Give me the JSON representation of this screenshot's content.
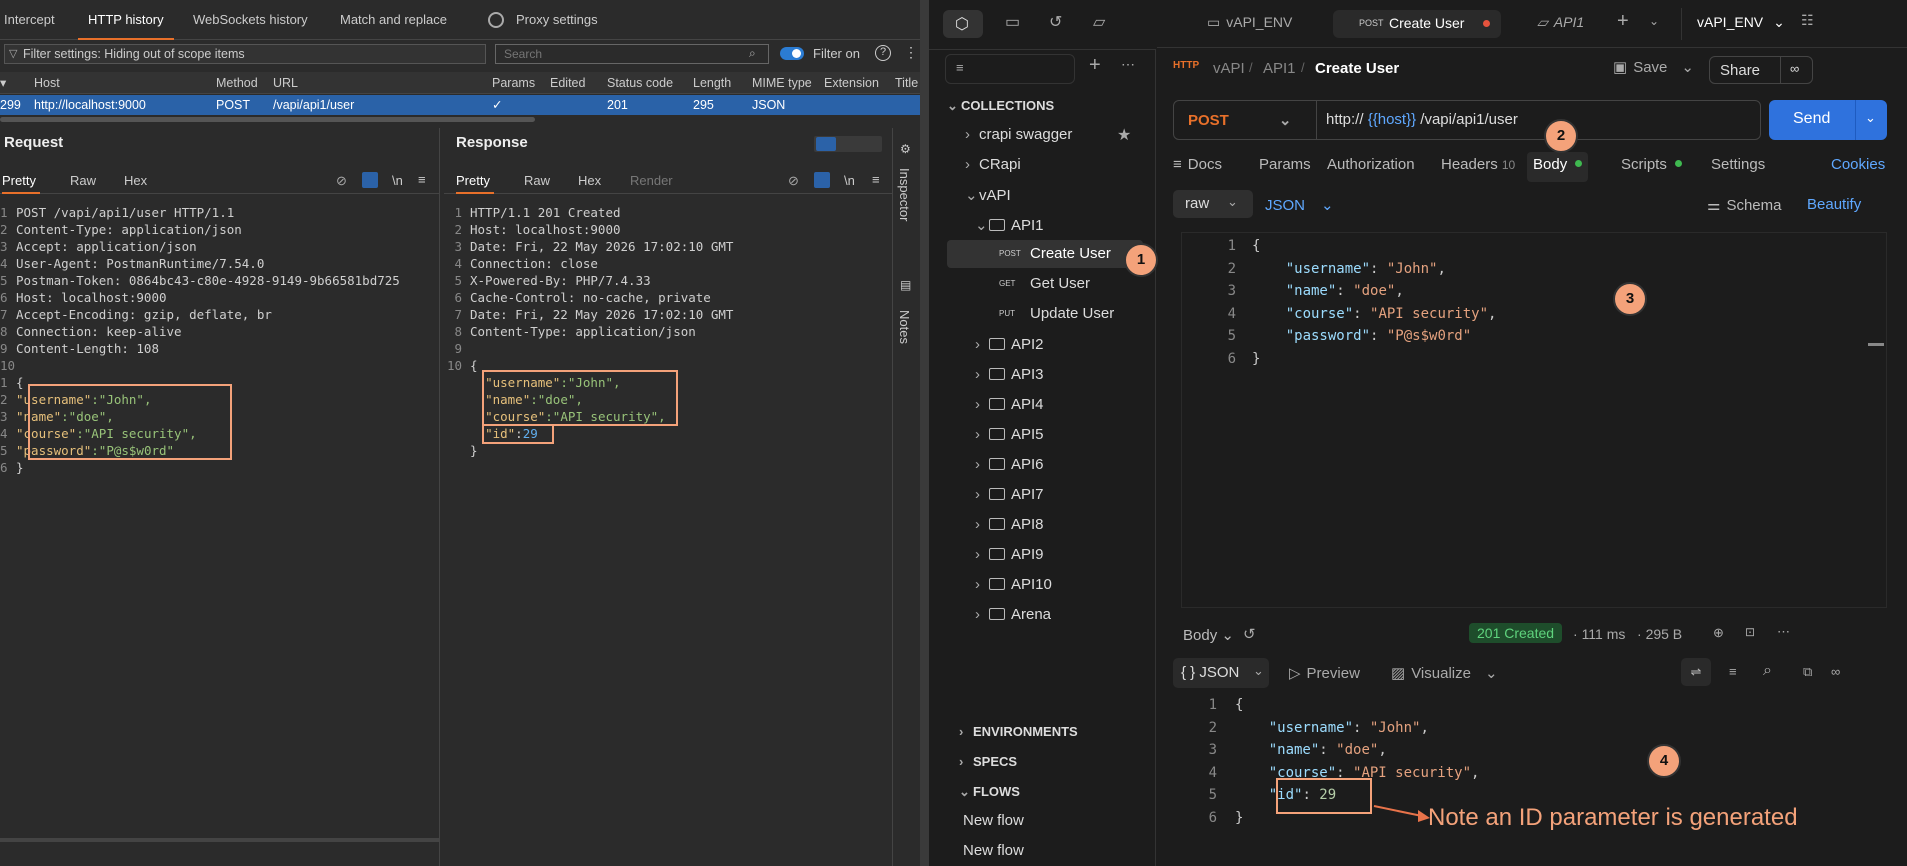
{
  "burp": {
    "tabs": [
      "Intercept",
      "HTTP history",
      "WebSockets history",
      "Match and replace",
      "Proxy settings"
    ],
    "filter_text": "Filter settings: Hiding out of scope items",
    "search_placeholder": "Search",
    "filter_on": "Filter on",
    "columns": [
      "#",
      "Host",
      "Method",
      "URL",
      "Params",
      "Edited",
      "Status code",
      "Length",
      "MIME type",
      "Extension",
      "Title"
    ],
    "row": {
      "num": "299",
      "host": "http://localhost:9000",
      "method": "POST",
      "url": "/vapi/api1/user",
      "params": "✓",
      "edited": "",
      "status": "201",
      "length": "295",
      "mime": "JSON",
      "ext": "",
      "title": ""
    },
    "request": {
      "title": "Request",
      "tabs": [
        "Pretty",
        "Raw",
        "Hex"
      ],
      "lines": [
        "POST /vapi/api1/user HTTP/1.1",
        "Content-Type: application/json",
        "Accept: application/json",
        "User-Agent: PostmanRuntime/7.54.0",
        "Postman-Token: 0864bc43-c80e-4928-9149-9b66581bd725",
        "Host: localhost:9000",
        "Accept-Encoding: gzip, deflate, br",
        "Connection: keep-alive",
        "Content-Length: 108",
        "",
        "{"
      ],
      "body": [
        [
          "\"username\"",
          ":\"John\","
        ],
        [
          "\"name\"",
          ":\"doe\","
        ],
        [
          "\"course\"",
          ":\"API security\","
        ],
        [
          "\"password\"",
          ":\"P@s$w0rd\""
        ]
      ],
      "close": "}",
      "numbers": [
        "1",
        "2",
        "3",
        "4",
        "5",
        "6",
        "7",
        "8",
        "9",
        "10",
        "1",
        "2",
        "3",
        "4",
        "5",
        "6"
      ]
    },
    "response": {
      "title": "Response",
      "tabs": [
        "Pretty",
        "Raw",
        "Hex",
        "Render"
      ],
      "lines": [
        "HTTP/1.1 201 Created",
        "Host: localhost:9000",
        "Date: Fri, 22 May 2026 17:02:10 GMT",
        "Connection: close",
        "X-Powered-By: PHP/7.4.33",
        "Cache-Control: no-cache, private",
        "Date: Fri, 22 May 2026 17:02:10 GMT",
        "Content-Type: application/json",
        "",
        "{"
      ],
      "body": [
        [
          "\"username\"",
          ":\"John\","
        ],
        [
          "\"name\"",
          ":\"doe\","
        ],
        [
          "\"course\"",
          ":\"API security\","
        ]
      ],
      "id_key": "\"id\"",
      "id_val": "29",
      "close": "}",
      "numbers": [
        "1",
        "2",
        "3",
        "4",
        "5",
        "6",
        "7",
        "8",
        "9",
        "10"
      ]
    },
    "side": {
      "inspector": "Inspector",
      "notes": "Notes"
    },
    "newline": "\\n"
  },
  "pm": {
    "tabs": [
      {
        "label": "vAPI_ENV"
      },
      {
        "method": "POST",
        "label": "Create User"
      },
      {
        "label": "API1"
      }
    ],
    "env": "vAPI_ENV",
    "breadcrumb": [
      "vAPI",
      "API1",
      "Create User"
    ],
    "save": "Save",
    "share": "Share",
    "method": "POST",
    "url": {
      "pre": "http://",
      "var": "{{host}}",
      "post": "/vapi/api1/user"
    },
    "send": "Send",
    "req_tabs": {
      "docs": "Docs",
      "params": "Params",
      "auth": "Authorization",
      "headers": "Headers",
      "headers_count": "10",
      "body": "Body",
      "scripts": "Scripts",
      "settings": "Settings",
      "cookies": "Cookies"
    },
    "body_mode": "raw",
    "body_lang": "JSON",
    "schema": "Schema",
    "beautify": "Beautify",
    "req_body": [
      [
        "\"username\"",
        "\"John\""
      ],
      [
        "\"name\"",
        "\"doe\""
      ],
      [
        "\"course\"",
        "\"API security\""
      ],
      [
        "\"password\"",
        "\"P@s$w0rd\""
      ]
    ],
    "collections_title": "COLLECTIONS",
    "collections": [
      "crapi swagger",
      "CRapi",
      "vAPI"
    ],
    "api1": "API1",
    "requests": [
      {
        "method": "POST",
        "label": "Create User"
      },
      {
        "method": "GET",
        "label": "Get User"
      },
      {
        "method": "PUT",
        "label": "Update User"
      }
    ],
    "folders": [
      "API2",
      "API3",
      "API4",
      "API5",
      "API6",
      "API7",
      "API8",
      "API9",
      "API10",
      "Arena"
    ],
    "sections": [
      "ENVIRONMENTS",
      "SPECS",
      "FLOWS"
    ],
    "flows": [
      "New flow",
      "New flow"
    ],
    "resp": {
      "body": "Body",
      "status": "201 Created",
      "time": "111 ms",
      "size": "295 B",
      "format": "{ } JSON",
      "preview": "Preview",
      "visualize": "Visualize",
      "lines": [
        [
          "\"username\"",
          "\"John\""
        ],
        [
          "\"name\"",
          "\"doe\""
        ],
        [
          "\"course\"",
          "\"API security\""
        ]
      ],
      "id_key": "\"id\"",
      "id_val": "29"
    },
    "note": "Note an ID parameter is generated",
    "badges": [
      "1",
      "2",
      "3",
      "4"
    ],
    "line_nums": [
      "1",
      "2",
      "3",
      "4",
      "5",
      "6"
    ]
  }
}
